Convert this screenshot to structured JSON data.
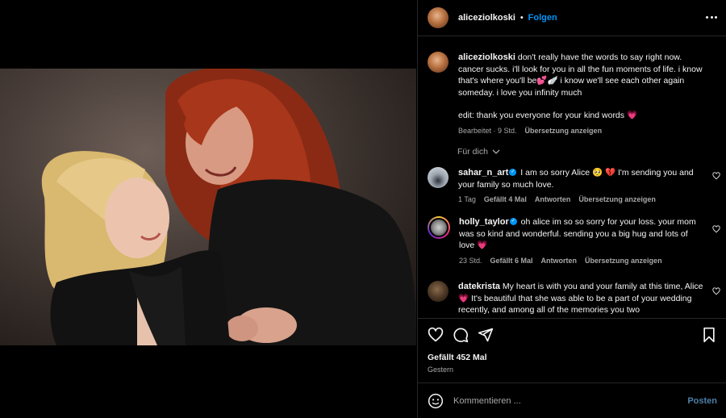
{
  "post": {
    "author": "aliceziolkoski",
    "follow_label": "Folgen",
    "separator": "•"
  },
  "caption": {
    "author": "aliceziolkoski",
    "text": "don't really have the words to say right now. cancer sucks. i'll look for you in all the fun moments of life. i know that's where you'll be💕🪽 i know we'll see each other again someday. i love you infinity much",
    "edit": "edit: thank you everyone for your kind words 💗",
    "meta_edited": "Bearbeitet · 9 Std.",
    "meta_translate": "Übersetzung anzeigen"
  },
  "for_you_label": "Für dich",
  "comments": [
    {
      "author": "sahar_n_art",
      "text": "I am so sorry Alice 🥺 💔 I'm sending you and your family so much love.",
      "time": "1 Tag",
      "likes": "Gefällt 4 Mal",
      "reply": "Antworten",
      "translate": "Übersetzung anzeigen"
    },
    {
      "author": "holly_taylor",
      "text": "oh alice im so so sorry for your loss. your mom was so kind and wonderful. sending you a big hug and lots of love 💗",
      "time": "23 Std.",
      "likes": "Gefällt 6 Mal",
      "reply": "Antworten",
      "translate": "Übersetzung anzeigen"
    },
    {
      "author": "datekrista",
      "text": "My heart is with you and your family at this time, Alice 💗 It's beautiful that she was able to be a part of your wedding recently, and among all of the memories you two"
    }
  ],
  "footer": {
    "likes": "Gefällt 452 Mal",
    "date": "Gestern",
    "comment_placeholder": "Kommentieren ...",
    "post_label": "Posten"
  },
  "colors": {
    "background": "#000000",
    "accent_blue": "#0095f6",
    "muted": "#a8a8a8",
    "heart": "#ff3040"
  }
}
